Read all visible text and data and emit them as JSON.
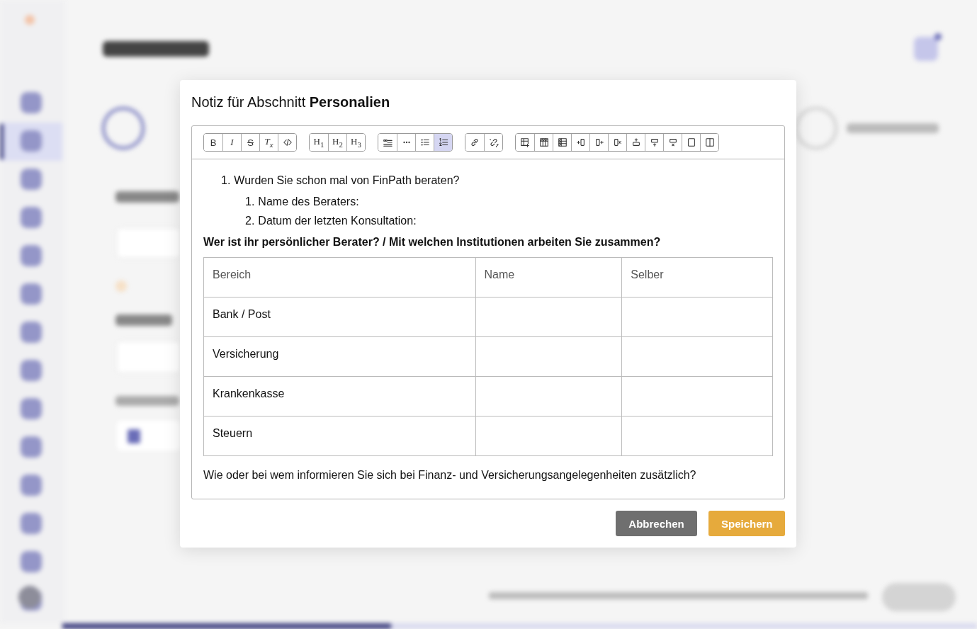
{
  "dialog": {
    "title": "Notiz für Abschnitt **Personalien**",
    "toolbar": [
      [
        {
          "kind": "bold",
          "label": "B",
          "selected": false
        },
        {
          "kind": "italic",
          "label": "I",
          "selected": false
        },
        {
          "kind": "strike",
          "label": "S",
          "selected": false
        },
        {
          "kind": "clear",
          "label": "T$_{x}$",
          "selected": false
        },
        {
          "kind": "code",
          "selected": false
        }
      ],
      [
        {
          "kind": "heading",
          "label": "H$_{1}$",
          "selected": false
        },
        {
          "kind": "heading",
          "label": "H$_{2}$",
          "selected": false
        },
        {
          "kind": "heading",
          "label": "H$_{3}$",
          "selected": false
        }
      ],
      [
        {
          "kind": "quote",
          "selected": false
        },
        {
          "kind": "rule",
          "selected": false
        },
        {
          "kind": "bullets",
          "selected": false
        },
        {
          "kind": "numbers",
          "selected": true
        }
      ],
      [
        {
          "kind": "link",
          "selected": false
        },
        {
          "kind": "unlink",
          "selected": false
        }
      ],
      [
        {
          "kind": "table",
          "selected": false
        },
        {
          "kind": "header-row",
          "selected": false
        },
        {
          "kind": "header-col",
          "selected": false
        },
        {
          "kind": "col-before",
          "selected": false
        },
        {
          "kind": "col-after",
          "selected": false
        },
        {
          "kind": "col-delete",
          "selected": false
        },
        {
          "kind": "row-before",
          "selected": false
        },
        {
          "kind": "row-after",
          "selected": false
        },
        {
          "kind": "row-delete",
          "selected": false
        },
        {
          "kind": "merge",
          "selected": false
        },
        {
          "kind": "split",
          "selected": false
        }
      ]
    ],
    "content": [
      {
        "kind": "ordered-list",
        "items": [
          {
            "number": "1.",
            "text": "Wurden Sie schon mal von FinPath beraten?",
            "children": [
              {
                "number": "1.",
                "text": "Name des Beraters:"
              },
              {
                "number": "2.",
                "text": "Datum der letzten Konsultation:"
              }
            ]
          }
        ]
      },
      {
        "kind": "bold-paragraph",
        "text": "Wer ist ihr persönlicher Berater? / Mit welchen Institutionen arbeiten Sie zusammen?"
      },
      {
        "kind": "table",
        "columns": [
          "Bereich",
          "Name",
          "Selber"
        ],
        "rows": [
          [
            "Bank / Post",
            "",
            ""
          ],
          [
            "Versicherung",
            "",
            ""
          ],
          [
            "Krankenkasse",
            "",
            ""
          ],
          [
            "Steuern",
            "",
            ""
          ]
        ]
      },
      {
        "kind": "paragraph",
        "text": "Wie oder bei wem informieren Sie sich bei Finanz- und Versicherungsangelegenheiten zusätzlich?"
      }
    ],
    "buttons": [
      {
        "kind": "secondary",
        "label": "Abbrechen"
      },
      {
        "kind": "primary",
        "label": "Speichern"
      }
    ]
  }
}
